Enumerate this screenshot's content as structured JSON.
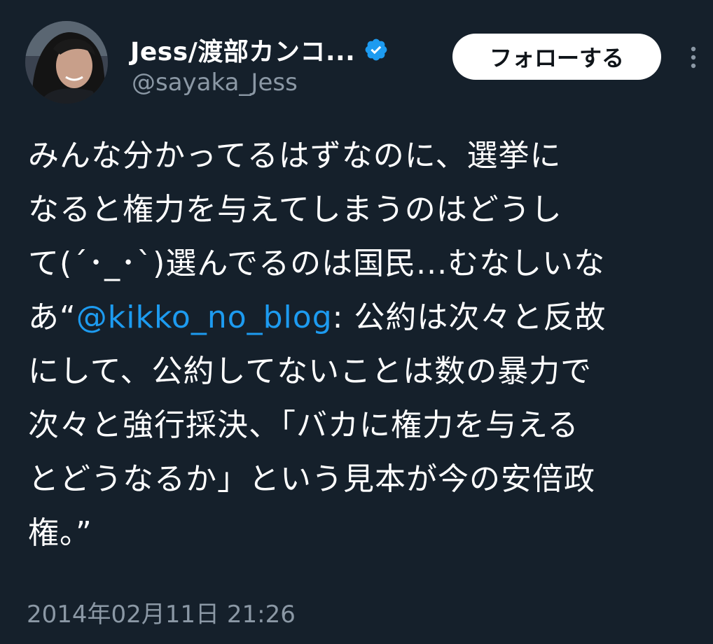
{
  "colors": {
    "background": "#15202b",
    "text": "#ffffff",
    "secondary_text": "#8b98a5",
    "link": "#1d9bf0",
    "verified_badge": "#1d9bf0"
  },
  "author": {
    "display_name": "Jess/渡部カンコ...",
    "handle": "@sayaka_Jess",
    "verified_icon": "verified-badge-icon",
    "avatar_icon": "avatar-photo"
  },
  "actions": {
    "follow_label": "フォローする",
    "more_icon": "more-vertical-icon"
  },
  "tweet": {
    "line1": "みんな分かってるはずなのに、選挙に",
    "line2": "なると権力を与えてしまうのはどうし",
    "line3": "て(´･_･`)選んでるのは国民...むなしいな",
    "line4_prefix": "あ“",
    "mention": "@kikko_no_blog",
    "line4_suffix": ": 公約は次々と反故",
    "line5": "にして、公約してないことは数の暴力で",
    "line6": "次々と強行採決、「バカに権力を与える",
    "line7": "とどうなるか」という見本が今の安倍政",
    "line8": "権。”"
  },
  "timestamp": "2014年02月11日 21:26"
}
